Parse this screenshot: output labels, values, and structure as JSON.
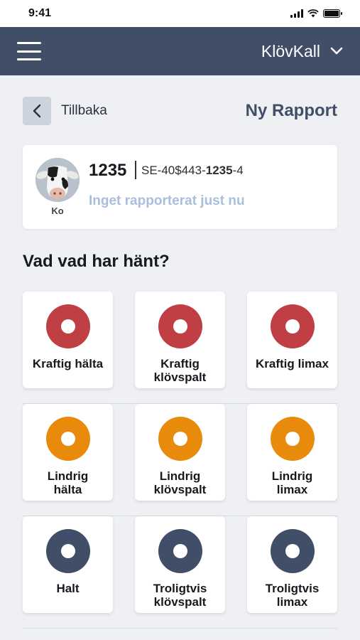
{
  "status_bar": {
    "time": "9:41"
  },
  "header": {
    "farm_name": "KlövKall"
  },
  "nav": {
    "back_label": "Tillbaka",
    "title": "Ny Rapport"
  },
  "animal": {
    "number": "1235",
    "id_prefix": "SE-40$443-",
    "id_highlight": "1235",
    "id_suffix": "-4",
    "avatar_caption": "Ko",
    "status": "Inget rapporterat just nu"
  },
  "question": "Vad vad har hänt?",
  "colors": {
    "severe": "#bf3f44",
    "mild": "#e88a0c",
    "uncertain": "#414e67",
    "header": "#414e67"
  },
  "options": [
    {
      "label_1": "Kraftig hälta",
      "label_2": "",
      "severity": "severe"
    },
    {
      "label_1": "Kraftig",
      "label_2": "klövspalt",
      "severity": "severe"
    },
    {
      "label_1": "Kraftig limax",
      "label_2": "",
      "severity": "severe"
    },
    {
      "label_1": "Lindrig",
      "label_2": "hälta",
      "severity": "mild"
    },
    {
      "label_1": "Lindrig",
      "label_2": "klövspalt",
      "severity": "mild"
    },
    {
      "label_1": "Lindrig",
      "label_2": "limax",
      "severity": "mild"
    },
    {
      "label_1": "Halt",
      "label_2": "",
      "severity": "uncertain"
    },
    {
      "label_1": "Troligtvis",
      "label_2": "klövspalt",
      "severity": "uncertain"
    },
    {
      "label_1": "Troligtvis",
      "label_2": "limax",
      "severity": "uncertain"
    }
  ]
}
